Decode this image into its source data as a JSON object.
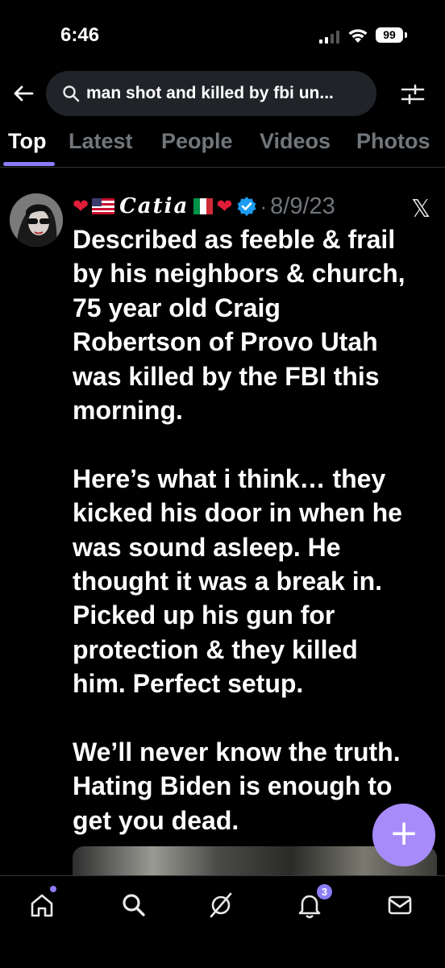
{
  "status_bar": {
    "time": "6:46",
    "battery": "99"
  },
  "search": {
    "query": "man shot and killed by fbi un..."
  },
  "tabs": [
    {
      "label": "Top",
      "active": true
    },
    {
      "label": "Latest",
      "active": false
    },
    {
      "label": "People",
      "active": false
    },
    {
      "label": "Videos",
      "active": false
    },
    {
      "label": "Photos",
      "active": false
    }
  ],
  "tweet": {
    "display_name": "Catia",
    "date": "8/9/23",
    "paragraphs": [
      "Described as feeble & frail\nby his neighbors & church,\n75 year old Craig\nRobertson of Provo Utah\nwas killed by the FBI this\nmorning.",
      "Here’s what i think… they\nkicked his door in when he\nwas sound asleep. He\nthought it was a break in.\nPicked up his gun for\nprotection & they killed\nhim. Perfect setup.",
      "We’ll never know the truth.\nHating Biden is enough to\nget you dead."
    ]
  },
  "nav": {
    "notifications_badge": "3"
  },
  "colors": {
    "accent": "#8b7cf6",
    "fab": "#a78bfa",
    "verified": "#1d9bf0",
    "muted_text": "#71767b",
    "search_bg": "#202327"
  }
}
